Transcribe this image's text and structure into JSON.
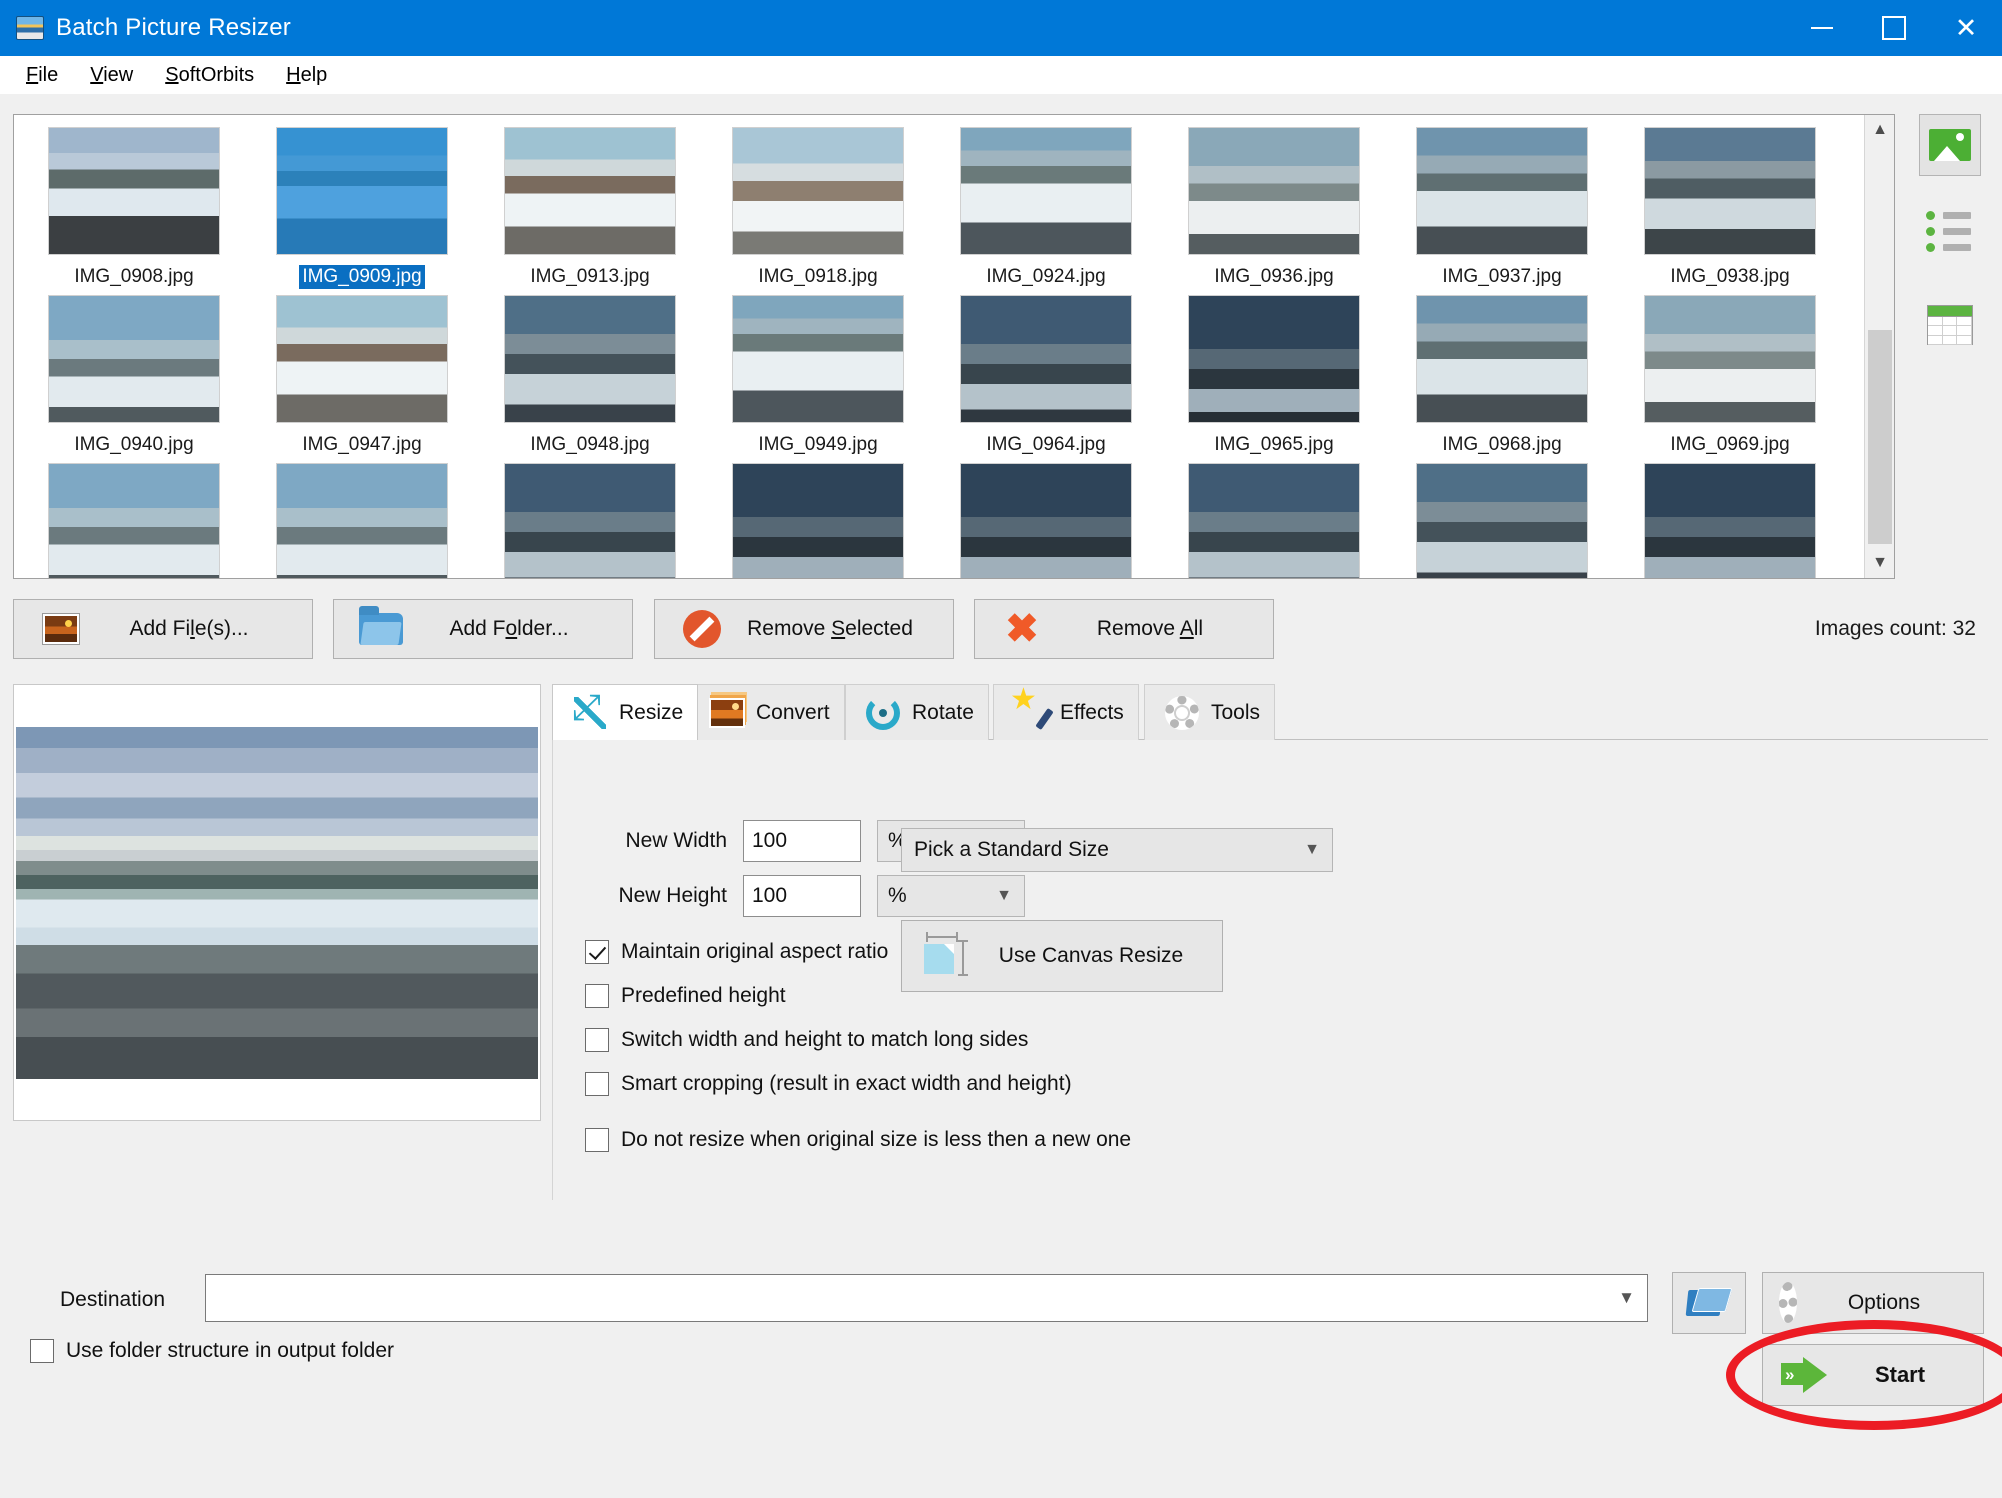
{
  "window": {
    "title": "Batch Picture Resizer",
    "app_icon": "picture-icon",
    "minimize": "–",
    "maximize": "□",
    "close": "×"
  },
  "menu": {
    "items": [
      {
        "label": "File",
        "mnemonic": "F"
      },
      {
        "label": "View",
        "mnemonic": "V"
      },
      {
        "label": "SoftOrbits",
        "mnemonic": "S"
      },
      {
        "label": "Help",
        "mnemonic": "H"
      }
    ]
  },
  "view_modes": [
    {
      "name": "thumbnails-view",
      "icon": "picture-icon",
      "active": true
    },
    {
      "name": "list-view",
      "icon": "list-icon",
      "active": false
    },
    {
      "name": "details-view",
      "icon": "table-icon",
      "active": false
    }
  ],
  "thumbnails": {
    "rows": [
      [
        {
          "name": "IMG_0908.jpg",
          "selected": false,
          "sea": "sea1"
        },
        {
          "name": "IMG_0909.jpg",
          "selected": true,
          "sea": "sea2"
        },
        {
          "name": "IMG_0913.jpg",
          "selected": false,
          "sea": "sea3"
        },
        {
          "name": "IMG_0918.jpg",
          "selected": false,
          "sea": "sea4"
        },
        {
          "name": "IMG_0924.jpg",
          "selected": false,
          "sea": "sea5"
        },
        {
          "name": "IMG_0936.jpg",
          "selected": false,
          "sea": "sea6"
        },
        {
          "name": "IMG_0937.jpg",
          "selected": false,
          "sea": "sea7"
        },
        {
          "name": "IMG_0938.jpg",
          "selected": false,
          "sea": "sea8"
        }
      ],
      [
        {
          "name": "IMG_0940.jpg",
          "selected": false,
          "sea": "sea9"
        },
        {
          "name": "IMG_0947.jpg",
          "selected": false,
          "sea": "sea3"
        },
        {
          "name": "IMG_0948.jpg",
          "selected": false,
          "sea": "sea10"
        },
        {
          "name": "IMG_0949.jpg",
          "selected": false,
          "sea": "sea5"
        },
        {
          "name": "IMG_0964.jpg",
          "selected": false,
          "sea": "sea11"
        },
        {
          "name": "IMG_0965.jpg",
          "selected": false,
          "sea": "sea12"
        },
        {
          "name": "IMG_0968.jpg",
          "selected": false,
          "sea": "sea7"
        },
        {
          "name": "IMG_0969.jpg",
          "selected": false,
          "sea": "sea6"
        }
      ],
      [
        {
          "name": "",
          "selected": false,
          "sea": "sea9"
        },
        {
          "name": "",
          "selected": false,
          "sea": "sea9"
        },
        {
          "name": "",
          "selected": false,
          "sea": "sea11"
        },
        {
          "name": "",
          "selected": false,
          "sea": "sea12"
        },
        {
          "name": "",
          "selected": false,
          "sea": "sea12"
        },
        {
          "name": "",
          "selected": false,
          "sea": "sea11"
        },
        {
          "name": "",
          "selected": false,
          "sea": "sea10"
        },
        {
          "name": "",
          "selected": false,
          "sea": "sea12"
        }
      ]
    ]
  },
  "actions": {
    "add_files": "Add File(s)...",
    "add_folder": "Add Folder...",
    "remove_selected": "Remove Selected",
    "remove_all": "Remove All",
    "images_count": "Images count: 32"
  },
  "tabs": [
    {
      "label": "Resize",
      "icon": "resize-icon",
      "active": true
    },
    {
      "label": "Convert",
      "icon": "convert-icon",
      "active": false
    },
    {
      "label": "Rotate",
      "icon": "rotate-icon",
      "active": false
    },
    {
      "label": "Effects",
      "icon": "effects-icon",
      "active": false
    },
    {
      "label": "Tools",
      "icon": "gear-icon",
      "active": false
    }
  ],
  "resize": {
    "new_width_label": "New Width",
    "new_width_value": "100",
    "new_width_unit": "%",
    "new_height_label": "New Height",
    "new_height_value": "100",
    "new_height_unit": "%",
    "standard_size": "Pick a Standard Size",
    "canvas_resize": "Use Canvas Resize",
    "checkboxes": [
      {
        "label": "Maintain original aspect ratio",
        "checked": true
      },
      {
        "label": "Predefined height",
        "checked": false
      },
      {
        "label": "Switch width and height to match long sides",
        "checked": false
      },
      {
        "label": "Smart cropping (result in exact width and height)",
        "checked": false
      },
      {
        "label": "Do not resize when original size is less then a new one",
        "checked": false
      }
    ]
  },
  "bottom": {
    "destination_label": "Destination",
    "destination_value": "",
    "use_folder_structure": "Use folder structure in output folder",
    "use_folder_structure_checked": false,
    "options": "Options",
    "start": "Start",
    "browse_icon": "open-folder-icon"
  },
  "annotation": {
    "shape": "ellipse",
    "color": "#ec1c24",
    "target": "start-button"
  }
}
